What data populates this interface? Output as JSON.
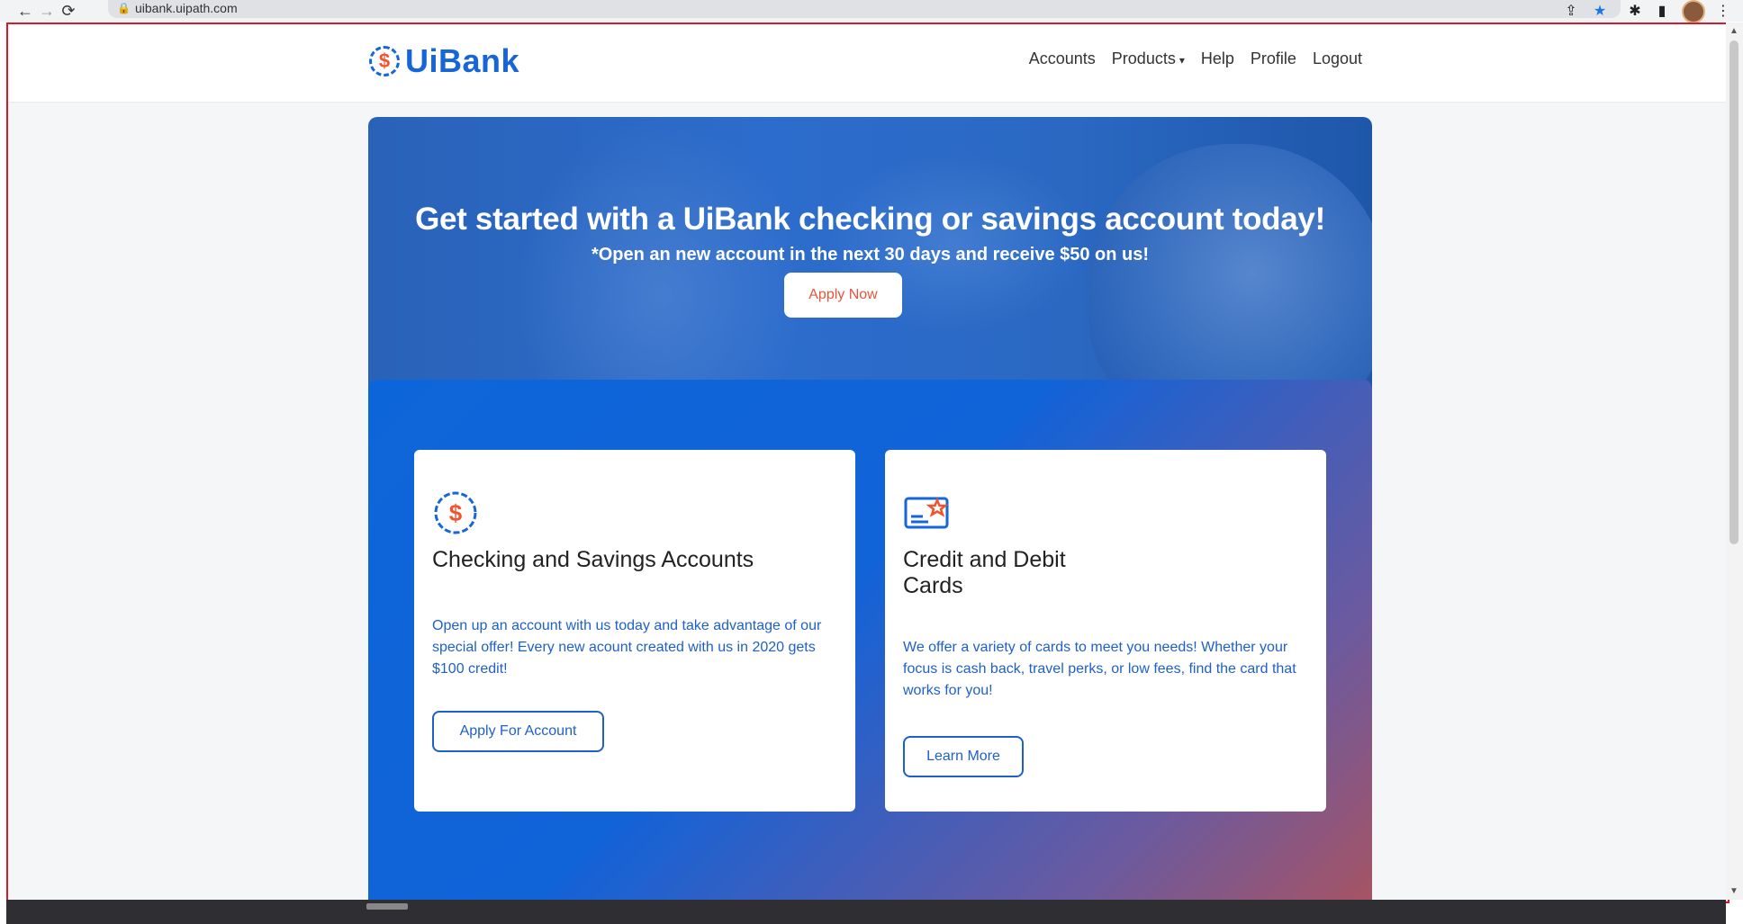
{
  "browser": {
    "url": "uibank.uipath.com",
    "back_icon": "←",
    "forward_icon": "→",
    "reload_icon": "⟳",
    "lock_icon": "🔒",
    "share_icon": "⇪",
    "star_icon": "★",
    "extensions_icon": "✱",
    "sidepanel_icon": "▮",
    "menu_icon": "⋮"
  },
  "header": {
    "logo_mark": "$",
    "logo_text": "UiBank",
    "nav": [
      "Accounts",
      "Products",
      "Help",
      "Profile",
      "Logout"
    ],
    "products_caret": "▾"
  },
  "hero": {
    "title": "Get started with a UiBank checking or savings account today!",
    "subtitle": "*Open an new account in the next 30 days and receive $50 on us!",
    "button": "Apply Now"
  },
  "cards": [
    {
      "title": "Checking and Savings Accounts",
      "description": "Open up an account with us today and take advantage of our special offer! Every new acount created with us in 2020 gets $100 credit!",
      "button": "Apply For Account"
    },
    {
      "title": "Credit and Debit Cards",
      "description": "We offer a variety of cards to meet you needs! Whether your focus is cash back, travel perks, or low fees, find the card that works for you!",
      "button": "Learn More"
    }
  ],
  "colors": {
    "brand_blue": "#1766d8",
    "brand_orange": "#f0542f",
    "viewport_border": "#d9192a"
  }
}
